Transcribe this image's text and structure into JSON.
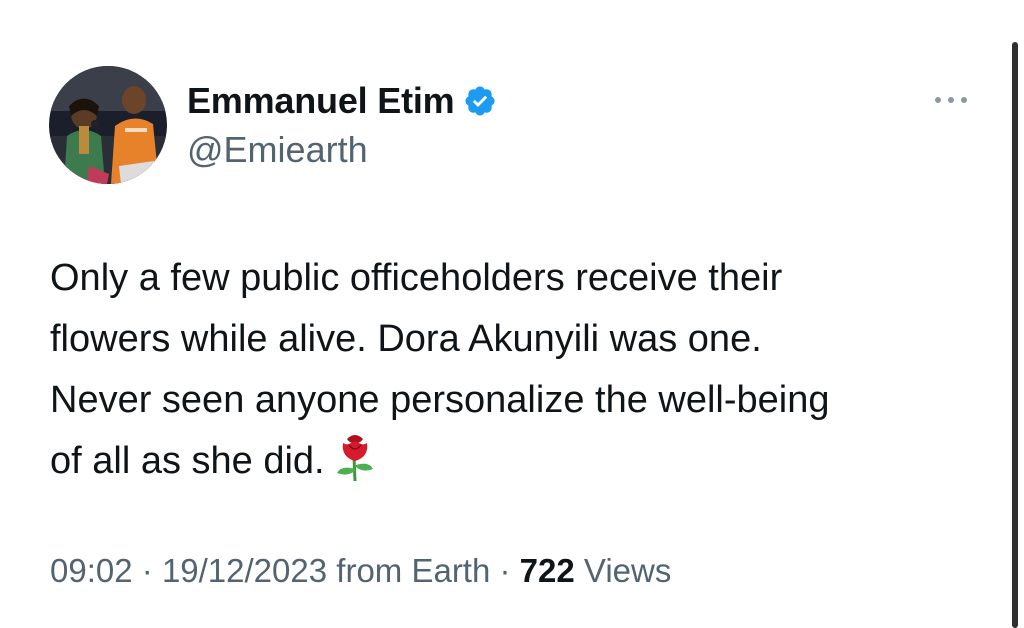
{
  "tweet": {
    "author": {
      "display_name": "Emmanuel Etim",
      "handle": "@Emiearth",
      "verified": true,
      "verified_color": "#1d9bf0",
      "avatar_icon": "profile-photo"
    },
    "more_icon": "more-horizontal-icon",
    "text": "Only a few public officeholders receive their\nflowers while alive. Dora Akunyili was one.\nNever seen anyone personalize the well-being\nof all as she did.",
    "emoji": "rose-emoji",
    "meta": {
      "time": "09:02",
      "date": "19/12/2023",
      "source": "from Earth",
      "separator": "·",
      "views_count": "722",
      "views_label": "Views"
    }
  },
  "colors": {
    "text": "#0f1419",
    "secondary": "#536471",
    "background": "#ffffff"
  }
}
